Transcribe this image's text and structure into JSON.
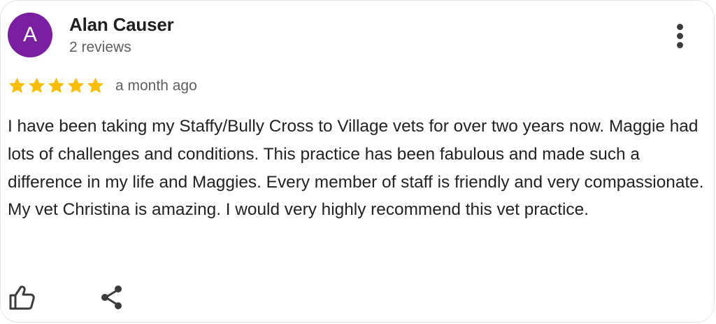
{
  "reviewer": {
    "initial": "A",
    "name": "Alan Causer",
    "reviews_count": "2 reviews",
    "avatar_color": "#7b1fa2"
  },
  "review": {
    "rating": 5,
    "max_rating": 5,
    "star_color": "#fbbc04",
    "date": "a month ago",
    "text": "I have been taking my Staffy/Bully Cross to Village vets for over two years now. Maggie had lots of challenges and conditions. This practice has been fabulous and made such a difference in my life and Maggies. Every member of staff is friendly and very compassionate. My vet Christina is amazing. I would very highly recommend this vet practice."
  },
  "actions": {
    "more_icon": "more-vert-icon",
    "like_icon": "thumbs-up-icon",
    "share_icon": "share-icon"
  }
}
